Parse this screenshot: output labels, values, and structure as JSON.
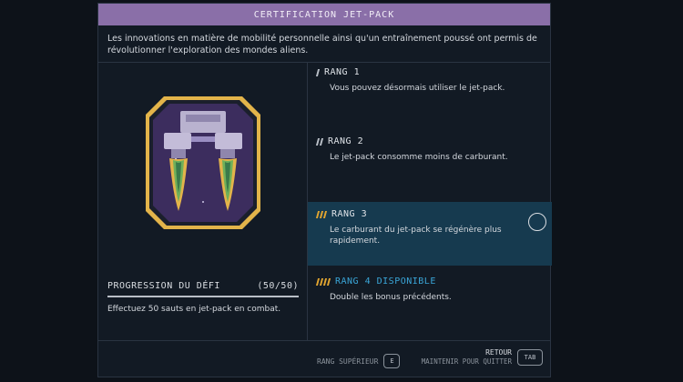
{
  "header": {
    "title": "CERTIFICATION JET-PACK"
  },
  "description": "Les innovations en matière de mobilité personnelle ainsi qu'un entraînement poussé ont permis de révolutionner l'exploration des mondes aliens.",
  "badge": {
    "icon": "jetpack-badge-icon",
    "colors": {
      "frame": "#e3b44a",
      "inner": "#3c2d5e",
      "accent": "#9a8ec2"
    }
  },
  "progress": {
    "label": "PROGRESSION DU DÉFI",
    "count": "(50/50)",
    "description": "Effectuez 50 sauts en jet-pack en combat."
  },
  "ranks": [
    {
      "title": "RANG 1",
      "text": "Vous pouvez désormais utiliser le jet-pack.",
      "pips": 1,
      "color": "#b9bfc7"
    },
    {
      "title": "RANG 2",
      "text": "Le jet-pack consomme moins de carburant.",
      "pips": 2,
      "color": "#b9bfc7"
    },
    {
      "title": "RANG 3",
      "text": "Le carburant du jet-pack se régénère plus rapidement.",
      "pips": 3,
      "color": "#e0a430",
      "selected": true
    },
    {
      "title": "RANG 4 DISPONIBLE",
      "text": "Double les bonus précédents.",
      "pips": 4,
      "color": "#e0a430",
      "available": true
    }
  ],
  "footer": {
    "rank_up_label": "RANG SUPÉRIEUR",
    "rank_up_key": "E",
    "back_label": "RETOUR",
    "back_sub": "MAINTENIR POUR QUITTER",
    "back_key": "TAB"
  },
  "colors": {
    "title_bar": "#8a6fa8",
    "selected_row": "#163a4f",
    "available": "#3aa6d8",
    "gold": "#e0a430"
  }
}
